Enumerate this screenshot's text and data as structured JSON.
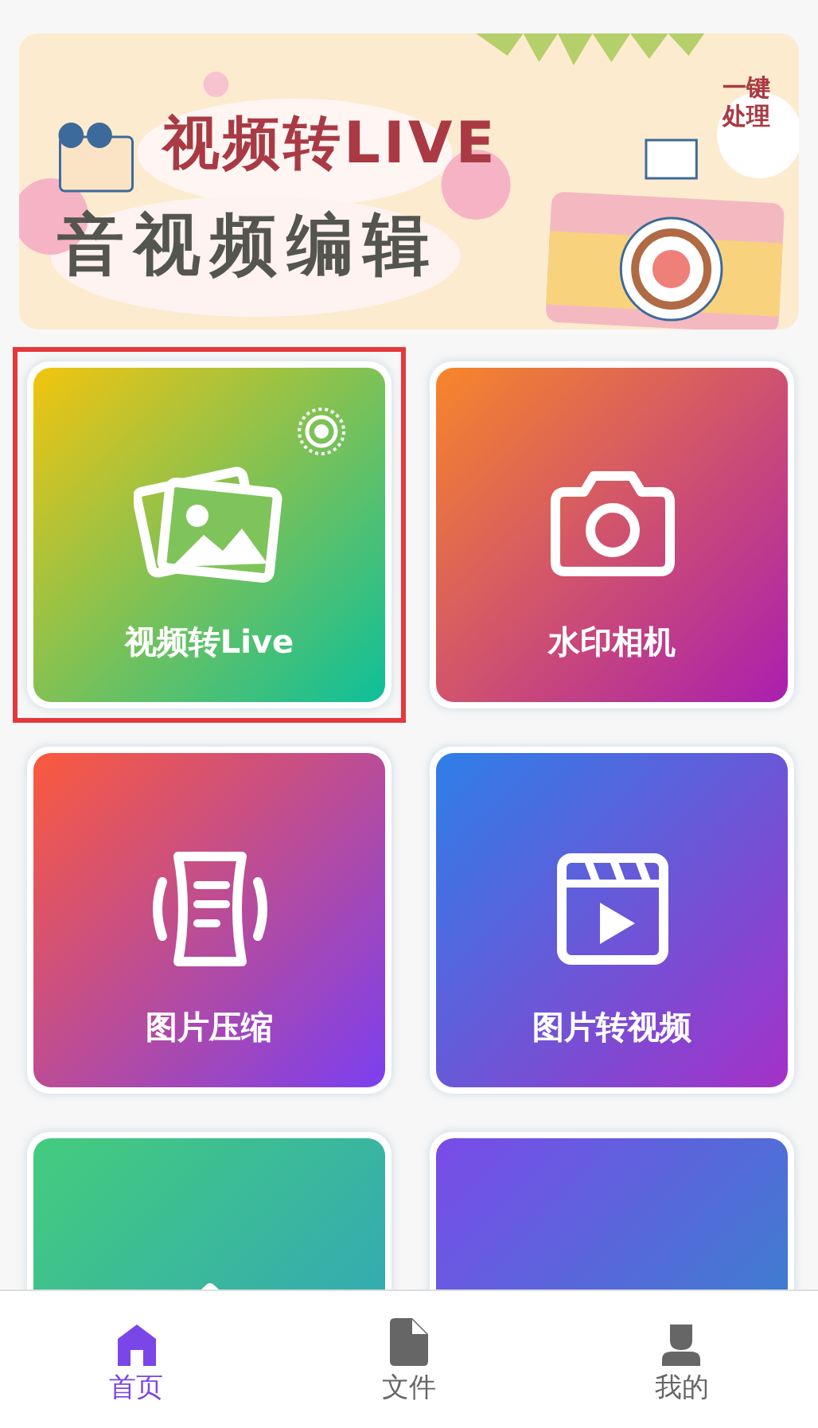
{
  "banner": {
    "kind": "picture",
    "title": "视频转LIVE",
    "subtitle": "音视频编辑",
    "badge": "一键处理"
  },
  "tools": [
    {
      "label": "视频转Live",
      "kind": "photos",
      "selected": true
    },
    {
      "label": "水印相机",
      "kind": "camera",
      "selected": false
    },
    {
      "label": "图片压缩",
      "kind": "compress",
      "selected": false
    },
    {
      "label": "图片转视频",
      "kind": "video",
      "selected": false
    },
    {
      "kind": "up",
      "selected": false
    },
    {
      "kind": "blank",
      "selected": false
    }
  ],
  "nav": [
    {
      "label": "首页",
      "selected": true
    },
    {
      "label": "文件",
      "selected": false
    },
    {
      "label": "我的",
      "selected": false
    }
  ]
}
